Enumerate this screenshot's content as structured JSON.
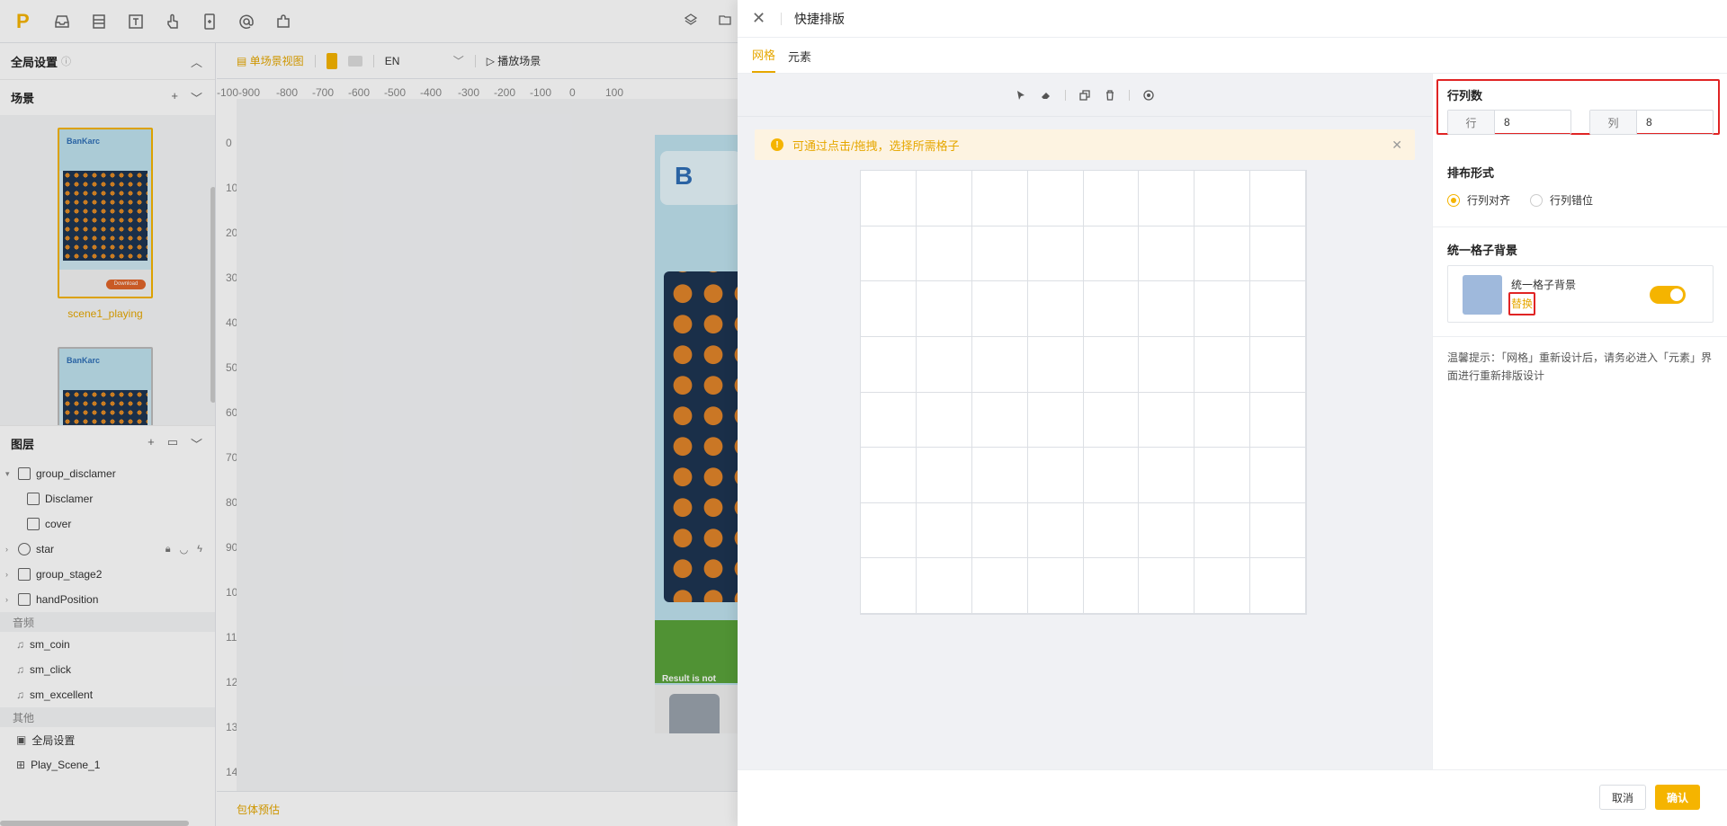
{
  "editor": {
    "global_settings": "全局设置",
    "scenes_label": "场景",
    "scene1_name": "scene1_playing",
    "thumb_brand": "BanKarc",
    "thumb_download": "Download",
    "layers_label": "图层",
    "layers": [
      {
        "name": "group_disclamer"
      },
      {
        "name": "Disclamer"
      },
      {
        "name": "cover"
      },
      {
        "name": "star"
      },
      {
        "name": "group_stage2"
      },
      {
        "name": "handPosition"
      }
    ],
    "audio_label": "音频",
    "audio": [
      "sm_coin",
      "sm_click",
      "sm_excellent"
    ],
    "other_label": "其他",
    "other": [
      "全局设置",
      "Play_Scene_1"
    ],
    "toolbar": {
      "single_view": "单场景视图",
      "language": "EN",
      "play_scene": "播放场景"
    },
    "ruler_x": [
      "-100",
      "-900",
      "-800",
      "-700",
      "-600",
      "-500",
      "-400",
      "-300",
      "-200",
      "-100",
      "0",
      "100"
    ],
    "ruler_y": [
      "0",
      "100",
      "200",
      "300",
      "400",
      "500",
      "600",
      "700",
      "800",
      "900",
      "1000",
      "1100",
      "1200",
      "1300",
      "1400"
    ],
    "phone_brand": "B",
    "phone_note": "Result is not guar",
    "bottom_action": "包体预估"
  },
  "drawer": {
    "title": "快捷排版",
    "tabs": [
      "网格",
      "元素"
    ],
    "active_tab": 0,
    "alert": "可通过点击/拖拽，选择所需格子",
    "grid": {
      "rows": 8,
      "cols": 8
    },
    "props": {
      "rowcol_label": "行列数",
      "row_label": "行",
      "row_value": "8",
      "col_label": "列",
      "col_value": "8",
      "layout_label": "排布形式",
      "layout_options": [
        "行列对齐",
        "行列错位"
      ],
      "layout_selected": 0,
      "bg_label": "统一格子背景",
      "bg_name": "统一格子背景",
      "bg_replace": "替换",
      "bg_color": "#9fb9dc",
      "bg_enabled": true,
      "tip": "温馨提示：「网格」重新设计后，请务必进入「元素」界面进行重新排版设计"
    },
    "footer": {
      "cancel": "取消",
      "confirm": "确认"
    }
  },
  "colors": {
    "accent": "#f5b400",
    "highlight": "#e02424"
  }
}
